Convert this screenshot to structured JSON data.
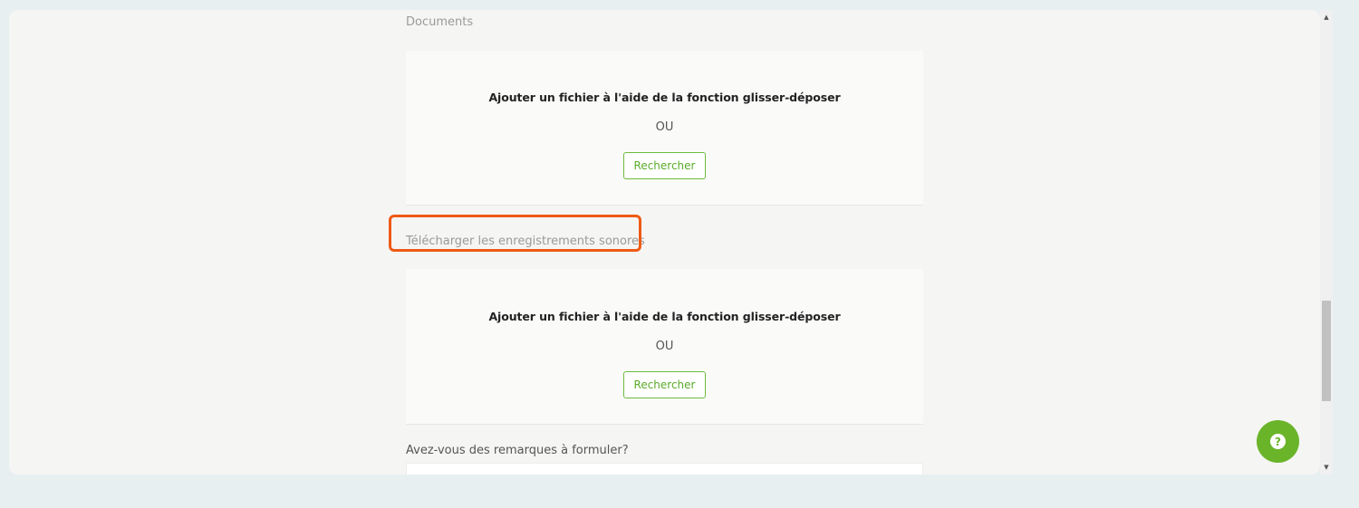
{
  "documents_label": "Documents",
  "dropzones": [
    {
      "text": "Ajouter un fichier à l'aide de la fonction glisser-déposer",
      "or": "OU",
      "button": "Rechercher"
    },
    {
      "text": "Ajouter un fichier à l'aide de la fonction glisser-déposer",
      "or": "OU",
      "button": "Rechercher"
    }
  ],
  "audio_label": "Télécharger les enregistrements sonores",
  "remarks_label": "Avez-vous des remarques à formuler?",
  "help_button": {
    "symbol": "?",
    "icon": "question-icon"
  },
  "scrollbar": {
    "up": "▲",
    "down": "▼",
    "position": 0.65
  },
  "colors": {
    "accent": "#6ab42a",
    "highlight": "#ef5a16"
  }
}
